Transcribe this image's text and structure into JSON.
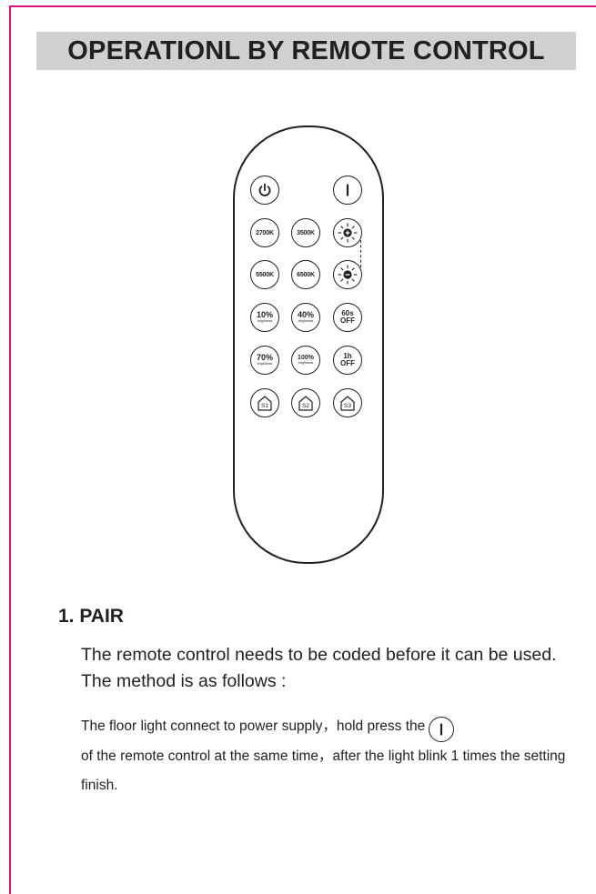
{
  "header": {
    "title": "OPERATIONL BY REMOTE CONTROL"
  },
  "remote": {
    "buttons": {
      "k2700": "2700K",
      "k3500": "3500K",
      "k5500": "5500K",
      "k6500": "6500K",
      "b10": "10%",
      "b40": "40%",
      "b70": "70%",
      "b100": "100%",
      "brightness": "brightness",
      "t60_top": "60s",
      "t60_bottom": "OFF",
      "t1h_top": "1h",
      "t1h_bottom": "OFF",
      "s1": "S1",
      "s2": "S2",
      "s3": "S3"
    },
    "icons": [
      "power-icon",
      "on-icon",
      "brightness-up-icon",
      "brightness-down-icon",
      "scene-icon"
    ]
  },
  "section": {
    "heading": "1. PAIR",
    "intro": "The remote control needs to be coded before it can be used. The method is as follows :",
    "step_before": "The floor light connect to power supply，hold press the",
    "step_after": "of the remote control at the same time，after the light blink 1 times the setting finish."
  }
}
